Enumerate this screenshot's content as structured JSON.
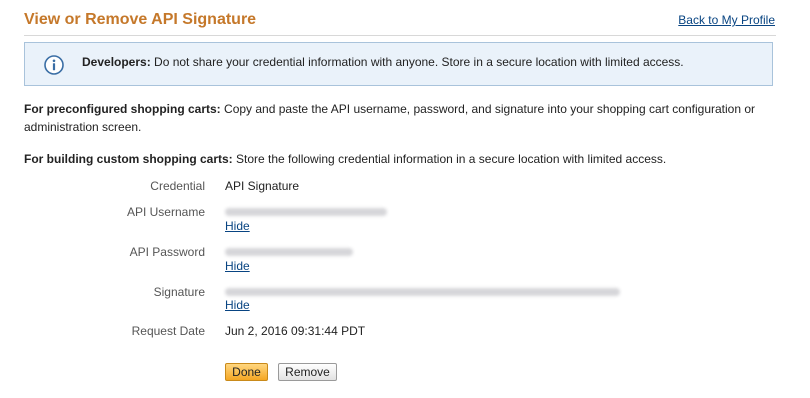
{
  "header": {
    "title": "View or Remove API Signature",
    "back_link": "Back to My Profile"
  },
  "info_box": {
    "icon": "info-icon",
    "bold": "Developers:",
    "text": " Do not share your credential information with anyone. Store in a secure location with limited access."
  },
  "paragraphs": {
    "preconfigured_bold": "For preconfigured shopping carts:",
    "preconfigured_text": " Copy and paste the API username, password, and signature into your shopping cart configuration or administration screen.",
    "custom_bold": "For building custom shopping carts:",
    "custom_text": " Store the following credential information in a secure location with limited access."
  },
  "fields": {
    "credential_label": "Credential",
    "credential_value": "API Signature",
    "username_label": "API Username",
    "password_label": "API Password",
    "signature_label": "Signature",
    "request_date_label": "Request Date",
    "request_date_value": "Jun 2, 2016 09:31:44 PDT",
    "hide_label": "Hide"
  },
  "buttons": {
    "done": "Done",
    "remove": "Remove"
  },
  "colors": {
    "title": "#c5782a",
    "link": "#084482",
    "info_bg": "#eaf2fa",
    "info_border": "#a9c3db",
    "done_button": "#f5a623"
  }
}
